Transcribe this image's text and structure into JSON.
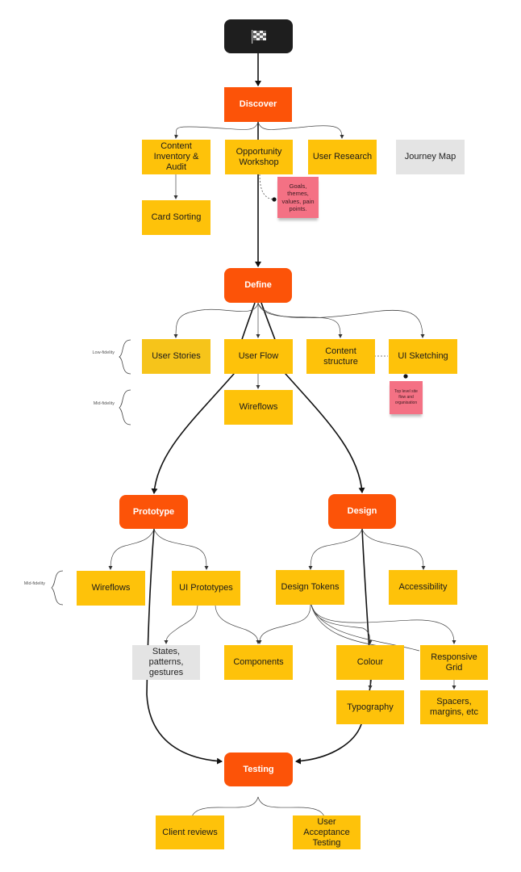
{
  "diagram": {
    "start": {
      "icon": "checkered-flag-icon"
    },
    "phases": {
      "discover": "Discover",
      "define": "Define",
      "prototype": "Prototype",
      "design": "Design",
      "testing": "Testing"
    },
    "discover_tasks": {
      "content_inventory": "Content Inventory & Audit",
      "opportunity_workshop": "Opportunity Workshop",
      "user_research": "User Research",
      "journey_map": "Journey Map",
      "card_sorting": "Card Sorting"
    },
    "define_tasks": {
      "user_stories": "User Stories",
      "user_flow": "User Flow",
      "content_structure": "Content structure",
      "ui_sketching": "UI Sketching",
      "wireflows": "Wireflows"
    },
    "prototype_tasks": {
      "wireflows": "Wireflows",
      "ui_prototypes": "UI Prototypes",
      "states_patterns": "States, patterns, gestures",
      "components": "Components"
    },
    "design_tasks": {
      "design_tokens": "Design Tokens",
      "accessibility": "Accessibility",
      "colour": "Colour",
      "responsive_grid": "Responsive Grid",
      "typography": "Typography",
      "spacers": "Spacers, margins, etc"
    },
    "testing_tasks": {
      "client_reviews": "Client reviews",
      "uat": "User Acceptance Testing"
    },
    "notes": {
      "workshop_note": "Goals, themes, values, pain points.",
      "sketching_note": "Top level site flow and organisation"
    },
    "fidelity_labels": {
      "low": "Low-fidelity",
      "mid": "Mid-fidelity",
      "mid2": "Mid-fidelity"
    },
    "colors": {
      "phase": "#fc5308",
      "task": "#fec20a",
      "neutral": "#e4e4e4",
      "sticky": "#f47184",
      "start": "#1e1e1e"
    }
  }
}
